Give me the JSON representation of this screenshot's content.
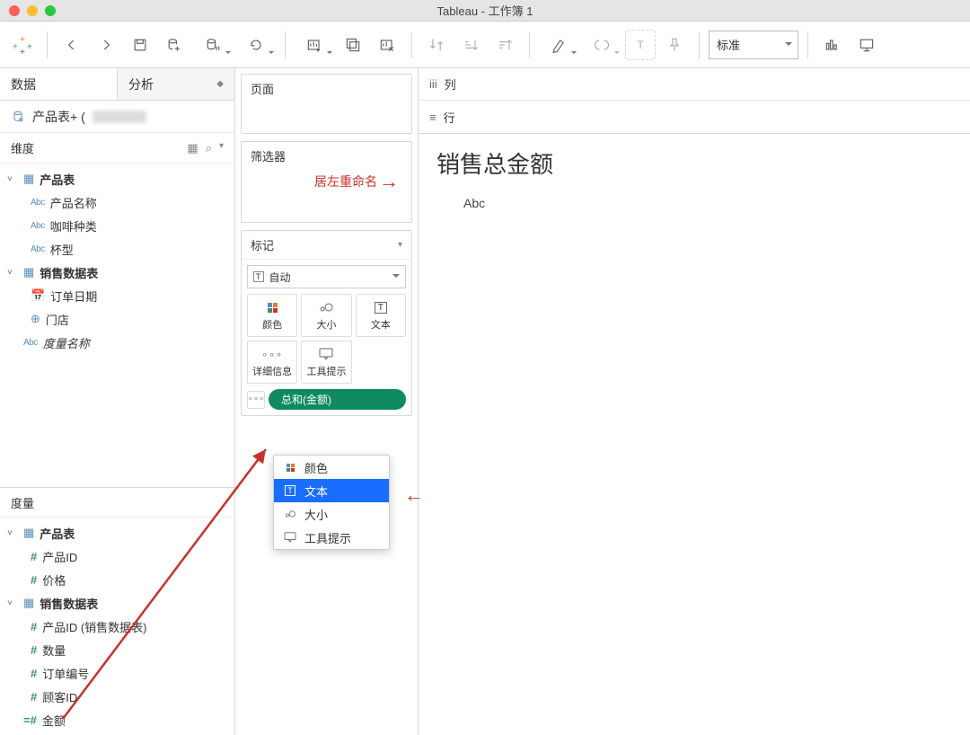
{
  "window": {
    "title": "Tableau - 工作簿 1"
  },
  "toolbar": {
    "fit_label": "标准"
  },
  "sidebar": {
    "tabs": {
      "data": "数据",
      "analytics": "分析"
    },
    "datasource": "产品表+ (",
    "dimensions_label": "维度",
    "measures_label": "度量",
    "dim_tree": {
      "t1": "产品表",
      "t1_items": [
        "产品名称",
        "咖啡种类",
        "杯型"
      ],
      "t2": "销售数据表",
      "t2_items": [
        "订单日期",
        "门店"
      ],
      "measure_names": "度量名称"
    },
    "meas_tree": {
      "t1": "产品表",
      "t1_items": [
        "产品ID",
        "价格"
      ],
      "t2": "销售数据表",
      "t2_items": [
        "产品ID (销售数据表)",
        "数量",
        "订单编号",
        "顾客ID"
      ],
      "loose": "金额"
    }
  },
  "cards": {
    "pages": "页面",
    "filters": "筛选器",
    "marks": "标记",
    "mark_type": "自动",
    "cells": {
      "color": "颜色",
      "size": "大小",
      "text": "文本",
      "detail": "详细信息",
      "tooltip": "工具提示"
    },
    "pill": "总和(金额)"
  },
  "popup": {
    "color": "颜色",
    "text": "文本",
    "size": "大小",
    "tooltip": "工具提示"
  },
  "shelves": {
    "columns": "列",
    "rows": "行"
  },
  "viz": {
    "title": "销售总金额",
    "placeholder": "Abc"
  },
  "annotation": {
    "rename": "居左重命名"
  }
}
